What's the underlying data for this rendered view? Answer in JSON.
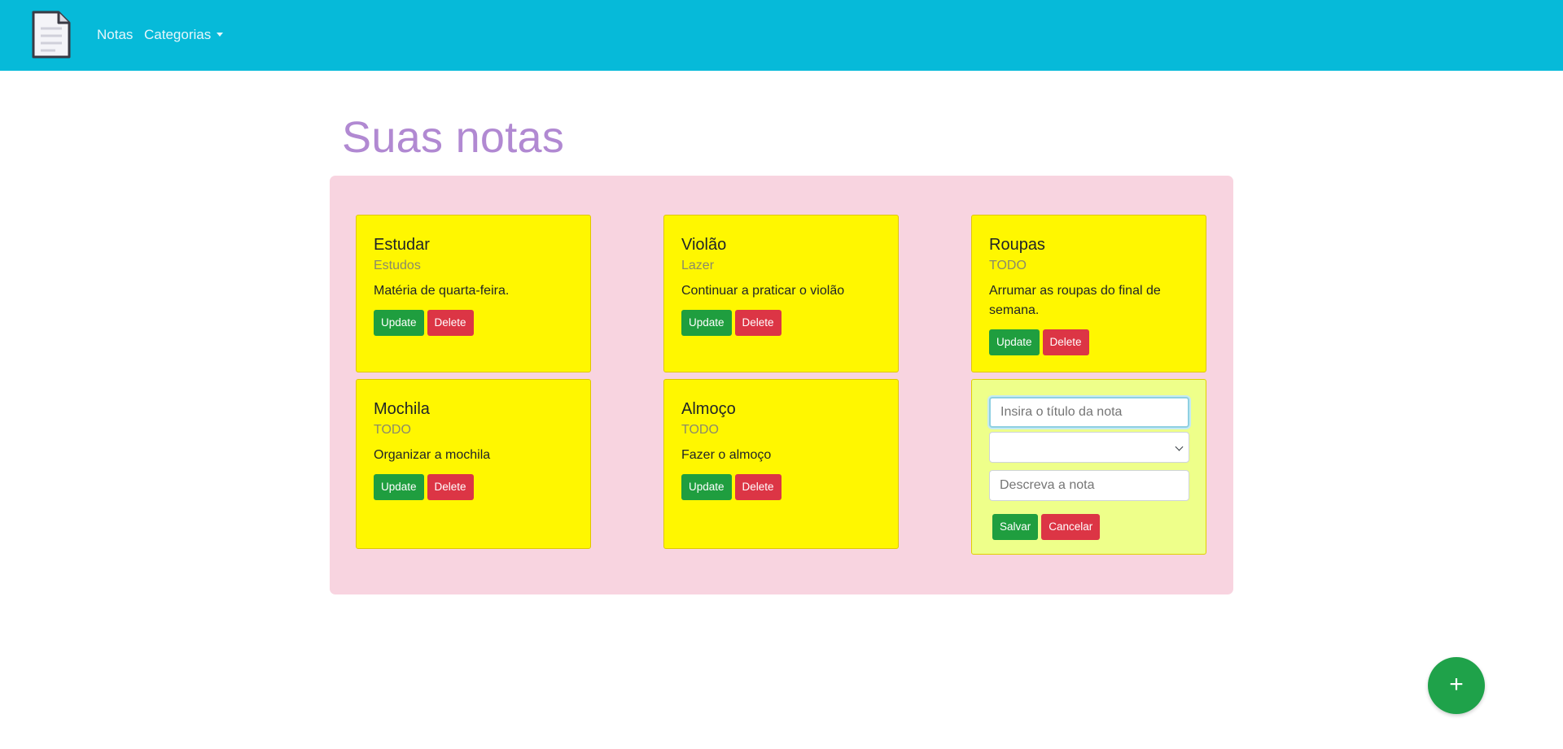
{
  "navbar": {
    "logo_icon": "document-icon",
    "links": [
      {
        "label": "Notas"
      },
      {
        "label": "Categorias"
      }
    ],
    "color": "#06bad9"
  },
  "page": {
    "title": "Suas notas"
  },
  "notes": [
    {
      "title": "Estudar",
      "category": "Estudos",
      "description": "Matéria de quarta-feira.",
      "update_label": "Update",
      "delete_label": "Delete"
    },
    {
      "title": "Violão",
      "category": "Lazer",
      "description": "Continuar a praticar o violão",
      "update_label": "Update",
      "delete_label": "Delete"
    },
    {
      "title": "Roupas",
      "category": "TODO",
      "description": "Arrumar as roupas do final de semana.",
      "update_label": "Update",
      "delete_label": "Delete"
    },
    {
      "title": "Mochila",
      "category": "TODO",
      "description": "Organizar a mochila",
      "update_label": "Update",
      "delete_label": "Delete"
    },
    {
      "title": "Almoço",
      "category": "TODO",
      "description": "Fazer o almoço",
      "update_label": "Update",
      "delete_label": "Delete"
    }
  ],
  "form": {
    "title_placeholder": "Insira o título da nota",
    "title_value": "",
    "category_selected": "",
    "description_placeholder": "Descreva a nota",
    "description_value": "",
    "save_label": "Salvar",
    "cancel_label": "Cancelar"
  },
  "fab": {
    "label": "+",
    "icon": "plus-icon"
  },
  "colors": {
    "note_bg": "#fff700",
    "form_bg": "#eeff8a",
    "board_bg": "#f8d4e0",
    "title": "#b189d2",
    "success": "#1f9e3f",
    "danger": "#dc3545"
  }
}
